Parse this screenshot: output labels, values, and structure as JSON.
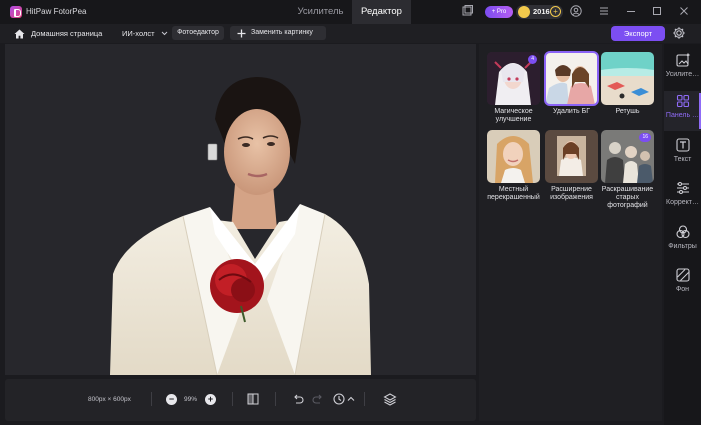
{
  "app": {
    "title": "HitPaw FotorPea"
  },
  "tabs": [
    {
      "label": "Усилитель",
      "active": false
    },
    {
      "label": "Редактор",
      "active": true
    }
  ],
  "titlebar": {
    "pro_label": "+ Pro",
    "coins": "2016",
    "icons": [
      "window-mode-icon",
      "user-icon",
      "menu-icon",
      "minimize-icon",
      "maximize-icon",
      "close-icon"
    ]
  },
  "toolbar": {
    "home_label": "Домашняя страница",
    "ai_label": "ИИ-холст",
    "photo_editor_label": "Фотоедактор",
    "replace_label": "Заменить картинку",
    "export_label": "Экспорт"
  },
  "canvas": {
    "size_label": "800px × 600px",
    "zoom": "99%"
  },
  "panel": {
    "cards": [
      {
        "label": "Магическое улучшение",
        "badge": "4",
        "selected": false
      },
      {
        "label": "Удалить БГ",
        "badge": "",
        "selected": true
      },
      {
        "label": "Ретушь",
        "badge": "",
        "selected": false
      },
      {
        "label": "Местный перекрашенный",
        "badge": "",
        "selected": false
      },
      {
        "label": "Расширение изображения",
        "badge": "",
        "selected": false
      },
      {
        "label": "Раскрашивание старых фотографий",
        "badge": "16",
        "selected": false
      }
    ]
  },
  "rail": {
    "items": [
      {
        "label": "Усилите…",
        "active": false
      },
      {
        "label": "Панель …",
        "active": true
      },
      {
        "label": "Текст",
        "active": false
      },
      {
        "label": "Коррект…",
        "active": false
      },
      {
        "label": "Фильтры",
        "active": false
      },
      {
        "label": "Фон",
        "active": false
      }
    ]
  },
  "colors": {
    "accent": "#7c4ef2",
    "background": "#1b1b1f",
    "canvas": "#27272c",
    "coin": "#f2c94c"
  }
}
